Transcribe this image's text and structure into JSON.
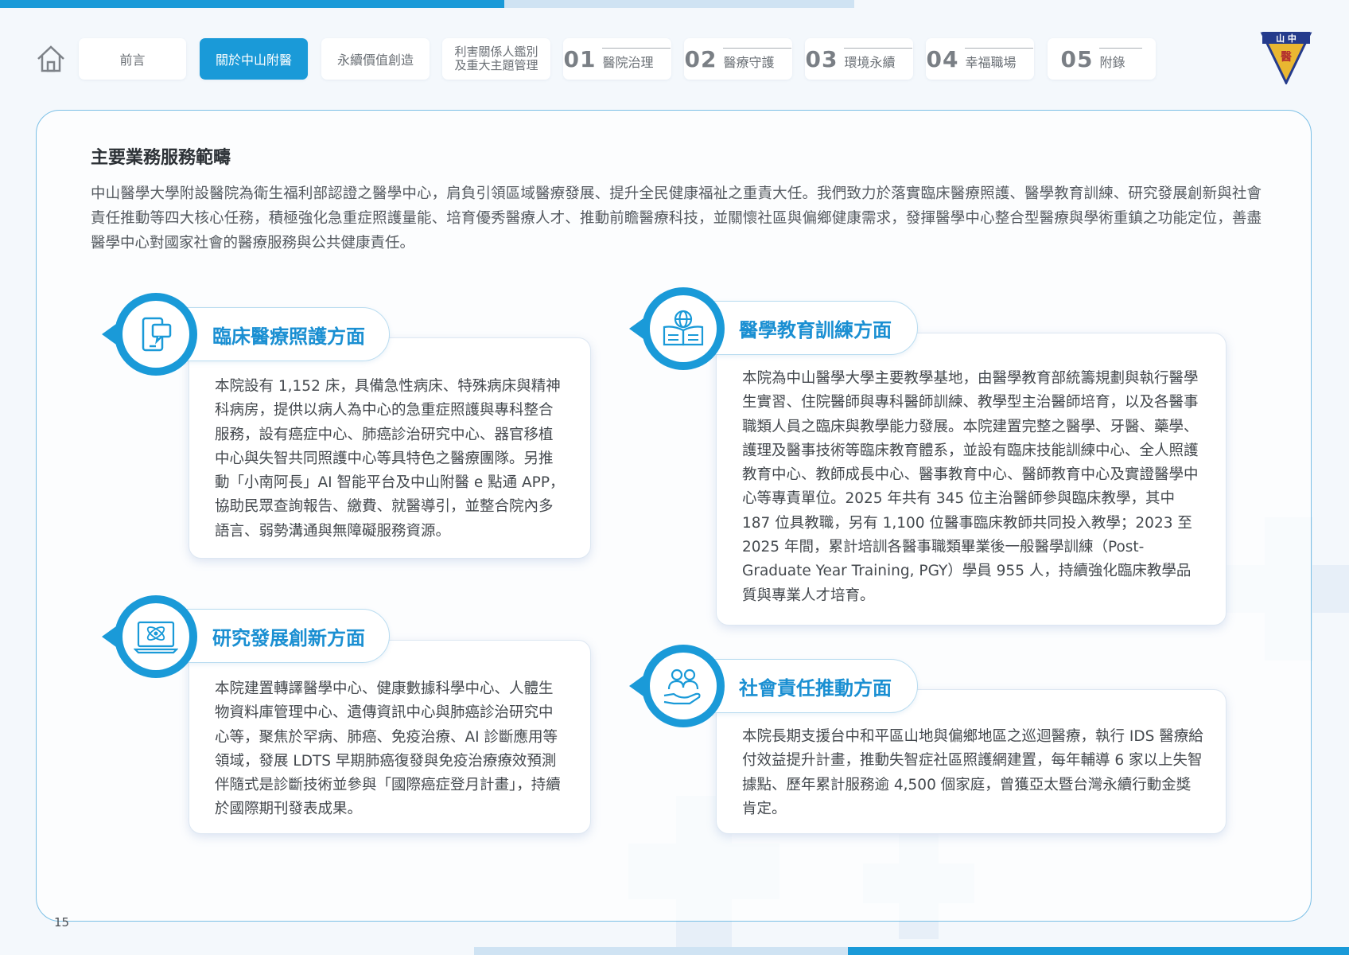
{
  "nav": {
    "tabs": [
      {
        "label": "前言"
      },
      {
        "label": "關於中山附醫"
      },
      {
        "label": "永續價值創造"
      },
      {
        "label_line1": "利害關係人鑑別",
        "label_line2": "及重大主題管理"
      },
      {
        "num": "01",
        "label": "醫院治理"
      },
      {
        "num": "02",
        "label": "醫療守護"
      },
      {
        "num": "03",
        "label": "環境永續"
      },
      {
        "num": "04",
        "label": "幸福職場"
      },
      {
        "num": "05",
        "label": "附錄"
      }
    ],
    "logo_text": "山 中",
    "logo_sub": "醫"
  },
  "section": {
    "title": "主要業務服務範疇",
    "intro": "中山醫學大學附設醫院為衛生福利部認證之醫學中心，肩負引領區域醫療發展、提升全民健康福祉之重責大任。我們致力於落實臨床醫療照護、醫學教育訓練、研究發展創新與社會責任推動等四大核心任務，積極強化急重症照護量能、培育優秀醫療人才、推動前瞻醫療科技，並關懷社區與偏鄉健康需求，發揮醫學中心整合型醫療與學術重鎮之功能定位，善盡醫學中心對國家社會的醫療服務與公共健康責任。"
  },
  "features": {
    "clinical": {
      "title": "臨床醫療照護方面",
      "body": "本院設有 1,152 床，具備急性病床、特殊病床與精神科病房，提供以病人為中心的急重症照護與專科整合服務，設有癌症中心、肺癌診治研究中心、器官移植中心與失智共同照護中心等具特色之醫療團隊。另推動「小南阿長」AI 智能平台及中山附醫 e 點通 APP，協助民眾查詢報告、繳費、就醫導引，並整合院內多語言、弱勢溝通與無障礙服務資源。"
    },
    "education": {
      "title": "醫學教育訓練方面",
      "body": "本院為中山醫學大學主要教學基地，由醫學教育部統籌規劃與執行醫學生實習、住院醫師與專科醫師訓練、教學型主治醫師培育，以及各醫事職類人員之臨床與教學能力發展。本院建置完整之醫學、牙醫、藥學、護理及醫事技術等臨床教育體系，並設有臨床技能訓練中心、全人照護教育中心、教師成長中心、醫事教育中心、醫師教育中心及實證醫學中心等專責單位。2025 年共有 345 位主治醫師參與臨床教學，其中 187 位具教職，另有 1,100 位醫事臨床教師共同投入教學；2023 至 2025 年間，累計培訓各醫事職類畢業後一般醫學訓練（Post-Graduate Year Training, PGY）學員 955 人，持續強化臨床教學品質與專業人才培育。"
    },
    "research": {
      "title": "研究發展創新方面",
      "body": "本院建置轉譯醫學中心、健康數據科學中心、人體生物資料庫管理中心、遺傳資訊中心與肺癌診治研究中心等，聚焦於罕病、肺癌、免疫治療、AI 診斷應用等領域，發展 LDTS 早期肺癌復發與免疫治療療效預測伴隨式是診斷技術並參與「國際癌症登月計畫」，持續於國際期刊發表成果。"
    },
    "social": {
      "title": "社會責任推動方面",
      "body": "本院長期支援台中和平區山地與偏鄉地區之巡迴醫療，執行 IDS 醫療給付效益提升計畫，推動失智症社區照護網建置，每年輔導 6 家以上失智據點、歷年累計服務逾 4,500 個家庭，曾獲亞太暨台灣永續行動金獎肯定。"
    }
  },
  "page_number": "15",
  "colors": {
    "accent": "#1a9ad8",
    "title_blue": "#1a8fd2",
    "bar_light": "#cfe3f3"
  }
}
